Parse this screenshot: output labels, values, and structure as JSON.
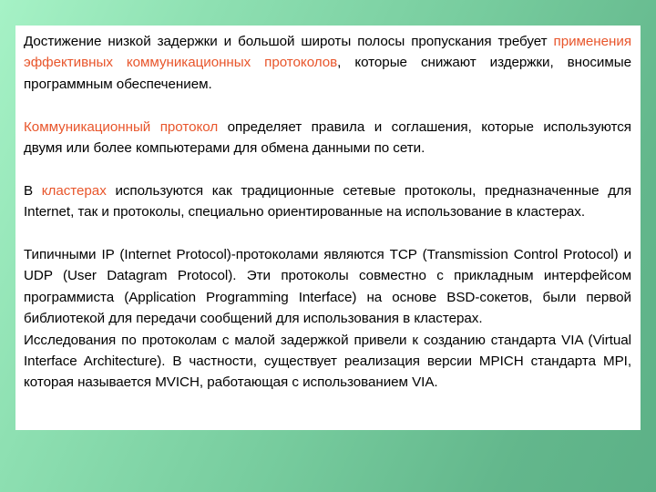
{
  "slide": {
    "background": {
      "gradient_from": "#a6f2c6",
      "gradient_to": "#5cb187",
      "direction": "top-left to bottom-right"
    },
    "panel": {
      "background": "#ffffff"
    },
    "accent_color": "#e8562c",
    "text_color": "#000000"
  },
  "body": {
    "paragraphs": [
      {
        "id": "p1",
        "gap_before": false,
        "runs": [
          {
            "text": "Достижение низкой задержки и большой широты полосы пропускания требует ",
            "style": "normal"
          },
          {
            "text": "применения эффективных коммуникационных протоколов",
            "style": "highlight"
          },
          {
            "text": ", которые снижают издержки, вносимые программным обеспечением.",
            "style": "normal"
          }
        ]
      },
      {
        "id": "p2",
        "gap_before": true,
        "runs": [
          {
            "text": "Коммуникационный протокол",
            "style": "highlight"
          },
          {
            "text": " определяет правила и соглашения, которые используются двумя или более компьютерами для обмена данными по сети.",
            "style": "normal"
          }
        ]
      },
      {
        "id": "p3",
        "gap_before": true,
        "runs": [
          {
            "text": "В ",
            "style": "normal"
          },
          {
            "text": "кластерах",
            "style": "highlight"
          },
          {
            "text": " используются как традиционные сетевые протоколы, предназначенные для Internet, так и протоколы, специально ориентированные на использование в кластерах.",
            "style": "normal"
          }
        ]
      },
      {
        "id": "p4",
        "gap_before": true,
        "runs": [
          {
            "text": "Типичными IP (Internet Protocol)-протоколами являются TCP (Transmission Control Protocol) и UDP (User Datagram Protocol). Эти протоколы совместно с прикладным интерфейсом программиста (Application Programming Interface) на основе BSD-сокетов, были первой библиотекой для передачи сообщений для использования в кластерах.",
            "style": "normal"
          }
        ]
      },
      {
        "id": "p5",
        "gap_before": false,
        "runs": [
          {
            "text": "Исследования по протоколам с малой задержкой привели к созданию стандарта VIA (Virtual Interface Architecture). В частности, существует реализация версии MPICH стандарта MPI, которая называется MVICH, работающая с использованием VIA.",
            "style": "normal"
          }
        ]
      }
    ]
  }
}
